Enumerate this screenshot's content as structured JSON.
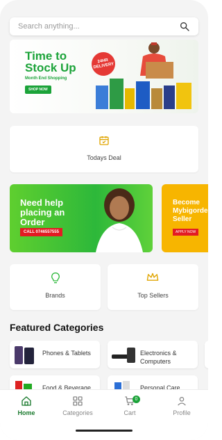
{
  "search": {
    "placeholder": "Search anything..."
  },
  "hero": {
    "title": "Time to Stock Up",
    "subtitle": "Month End Shopping",
    "button": "SHOP NOW",
    "badge": "24HR DELIVERY"
  },
  "todays_deal": {
    "label": "Todays Deal"
  },
  "promos": [
    {
      "title": "Need help placing an Order",
      "button": "CALL 0746557555"
    },
    {
      "title": "Become Mybigorder Seller",
      "button": "APPLY NOW"
    }
  ],
  "brands": {
    "label": "Brands"
  },
  "top_sellers": {
    "label": "Top Sellers"
  },
  "featured": {
    "title": "Featured Categories",
    "items": [
      {
        "label": "Phones & Tablets"
      },
      {
        "label": "Electronics & Computers"
      },
      {
        "label": "Food & Beverage"
      },
      {
        "label": "Personal Care"
      }
    ]
  },
  "nav": {
    "items": [
      {
        "label": "Home",
        "icon": "home-icon"
      },
      {
        "label": "Categories",
        "icon": "grid-icon"
      },
      {
        "label": "Cart",
        "icon": "cart-icon"
      },
      {
        "label": "Profile",
        "icon": "profile-icon"
      }
    ],
    "cart_count": "0"
  },
  "colors": {
    "accent": "#1ba339",
    "promo_red": "#e31b23",
    "promo_yellow": "#f7b500"
  }
}
